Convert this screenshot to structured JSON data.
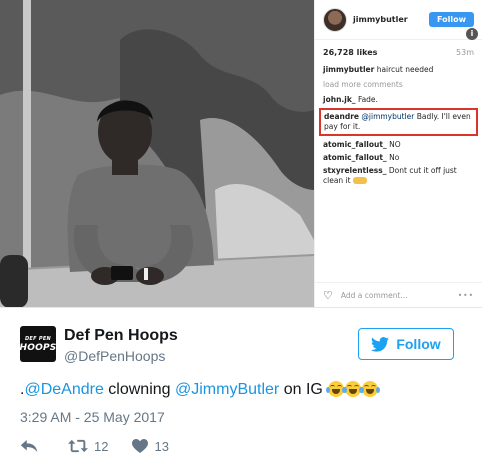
{
  "instagram": {
    "username": "jimmybutler",
    "follow_label": "Follow",
    "info_glyph": "i",
    "likes": "26,728 likes",
    "time": "53m",
    "caption_user": "jimmybutler",
    "caption_text": "haircut needed",
    "load_more": "load more comments",
    "comments": [
      {
        "user": "john.jk_",
        "text": "Fade."
      },
      {
        "user": "deandre",
        "mention": "@jimmybutler",
        "text": "Badly. I'll even pay for it.",
        "highlighted": true
      },
      {
        "user": "atomic_fallout_",
        "text": "NO"
      },
      {
        "user": "atomic_fallout_",
        "text": "No"
      },
      {
        "user": "stxyrelentless_",
        "text": "Dont cut it off just clean it"
      }
    ],
    "add_comment_placeholder": "Add a comment...",
    "more_glyph": "•••",
    "highlight_color": "#d9362b",
    "follow_color": "#3897f0"
  },
  "tweet": {
    "avatar_text_top": "DEF PEN",
    "avatar_text_bottom": "HOOPS",
    "author_name": "Def Pen Hoops",
    "author_handle": "@DefPenHoops",
    "follow_label": "Follow",
    "text_prefix": ".",
    "mention_1": "@DeAndre",
    "text_mid": " clowning ",
    "mention_2": "@JimmyButler",
    "text_after": " on IG ",
    "emoji_name": "face-with-tears-of-joy",
    "emoji_count": 3,
    "timestamp": "3:29 AM - 25 May 2017",
    "retweet_count": "12",
    "like_count": "13",
    "icons": [
      "reply-icon",
      "retweet-icon",
      "heart-icon",
      "twitter-bird-icon"
    ],
    "accent_color": "#1da1f2",
    "mention_color": "#1b95e0",
    "secondary_text_color": "#657786"
  }
}
